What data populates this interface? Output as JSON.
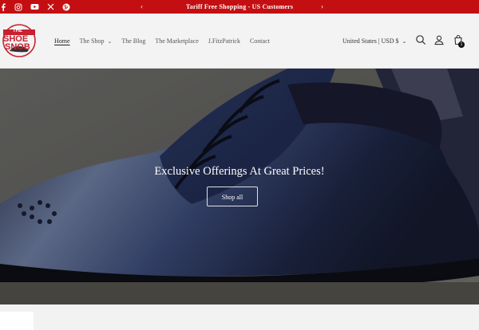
{
  "announcement": {
    "text": "Tariff Free Shopping - US Customers",
    "prev_icon": "‹",
    "next_icon": "›",
    "social_icons": [
      "facebook-icon",
      "instagram-icon",
      "youtube-icon",
      "x-icon",
      "pinterest-icon"
    ]
  },
  "header": {
    "logo_text_top": "THE",
    "logo_text_mid": "SHOE",
    "logo_text_bottom": "SNOB",
    "nav": [
      {
        "label": "Home"
      },
      {
        "label": "The Shop"
      },
      {
        "label": "The Blog"
      },
      {
        "label": "The Marketplace"
      },
      {
        "label": "J.FitzPatrick"
      },
      {
        "label": "Contact"
      }
    ],
    "country": "United States | USD $",
    "cart_count": "1"
  },
  "hero": {
    "title": "Exclusive Offerings At Great Prices!",
    "button": "Shop all"
  },
  "colors": {
    "announcement_bg": "#c40f12",
    "brand_red": "#c8202f"
  }
}
